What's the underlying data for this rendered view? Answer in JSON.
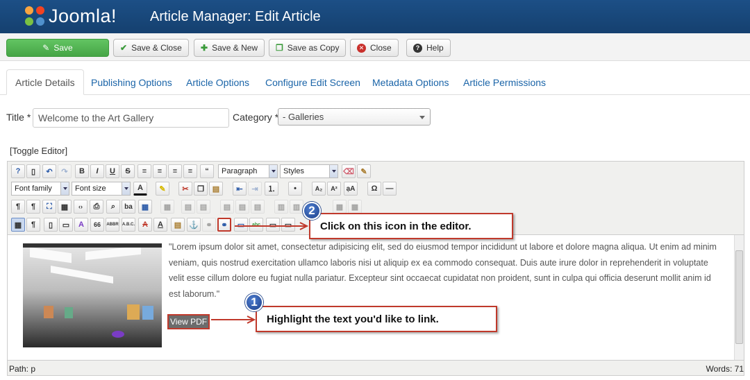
{
  "header": {
    "logo_text": "Joomla!",
    "title": "Article Manager: Edit Article"
  },
  "toolbar": {
    "save": "Save",
    "save_close": "Save & Close",
    "save_new": "Save & New",
    "save_copy": "Save as Copy",
    "close": "Close",
    "help": "Help"
  },
  "tabs": [
    "Article Details",
    "Publishing Options",
    "Article Options",
    "Configure Edit Screen",
    "Metadata Options",
    "Article Permissions"
  ],
  "form": {
    "title_label": "Title *",
    "title_value": "Welcome to the Art Gallery",
    "category_label": "Category *",
    "category_value": "- Galleries"
  },
  "editor": {
    "toggle": "[Toggle Editor]",
    "format_select": "Paragraph",
    "styles_select": "Styles",
    "font_family": "Font family",
    "font_size": "Font size",
    "body_text": "\"Lorem ipsum dolor sit amet, consectetur adipisicing elit, sed do eiusmod tempor incididunt ut labore et dolore magna aliqua. Ut enim ad minim veniam, quis nostrud exercitation ullamco laboris nisi ut aliquip ex ea commodo consequat. Duis aute irure dolor in reprehenderit in voluptate velit esse cillum dolore eu fugiat nulla pariatur. Excepteur sint occaecat cupidatat non proident, sunt in culpa qui officia deserunt mollit anim id est laborum.\"",
    "link_text": "View PDF",
    "status_path": "Path: p",
    "status_words": "Words: 71"
  },
  "annotations": {
    "step1_number": "1",
    "step1_text": "Highlight the text you'd like to link.",
    "step2_number": "2",
    "step2_text": "Click on this icon in the editor."
  },
  "colors": {
    "header_bg": "#1c4f86",
    "save_green": "#46a546",
    "link_blue": "#1a64a8",
    "callout_red": "#c0392b"
  }
}
